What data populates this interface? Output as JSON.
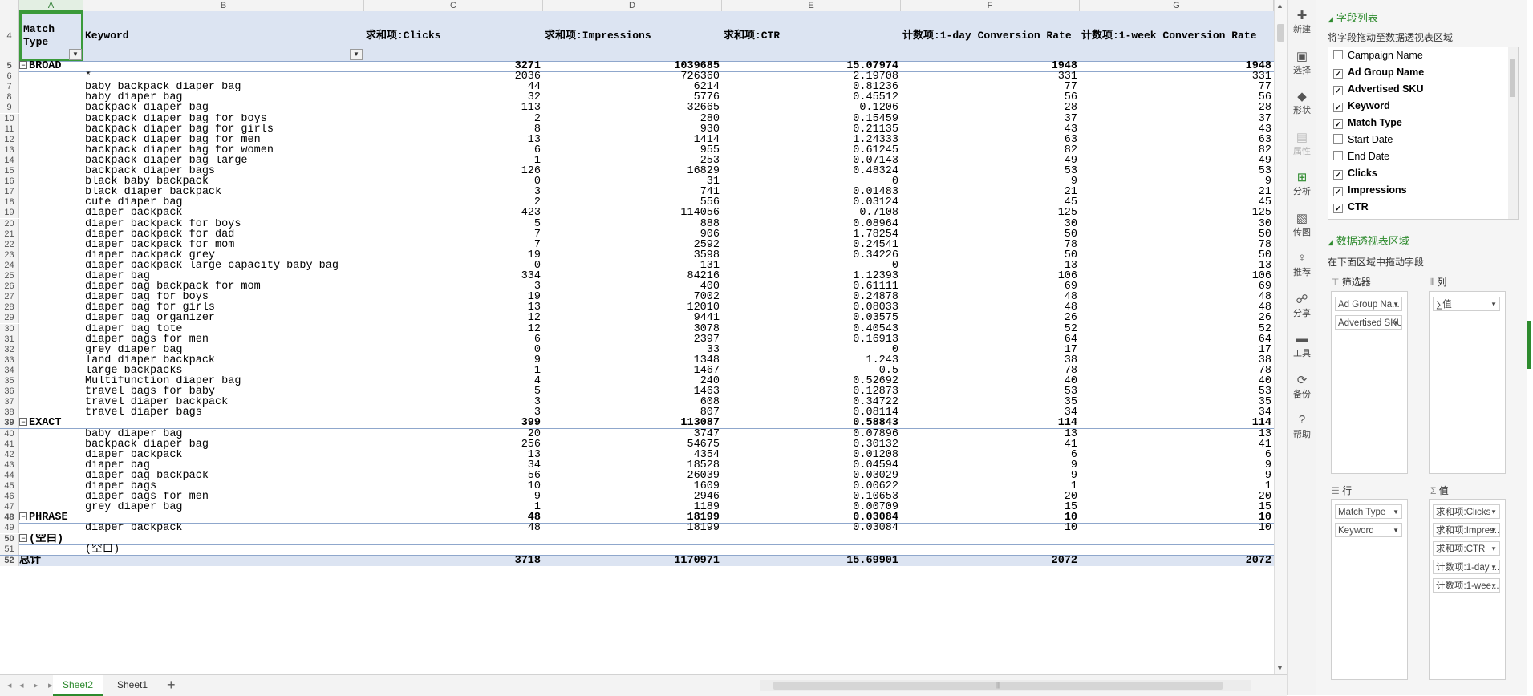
{
  "columns": [
    "A",
    "B",
    "C",
    "D",
    "E",
    "F",
    "G"
  ],
  "header": {
    "row_num": "4",
    "cells": [
      "Match Type",
      "Keyword",
      "求和项:Clicks",
      "求和项:Impressions",
      "求和项:CTR",
      "计数项:1-day Conversion Rate",
      "计数项:1-week Conversion Rate"
    ]
  },
  "rows": [
    {
      "n": "5",
      "kind": "group",
      "label": "BROAD",
      "vals": [
        "3271",
        "1039685",
        "15.07974",
        "1948",
        "1948"
      ]
    },
    {
      "n": "6",
      "kw": "*",
      "vals": [
        "2036",
        "726360",
        "2.19708",
        "331",
        "331"
      ]
    },
    {
      "n": "7",
      "kw": "baby backpack diaper bag",
      "vals": [
        "44",
        "6214",
        "0.81236",
        "77",
        "77"
      ]
    },
    {
      "n": "8",
      "kw": "baby diaper bag",
      "vals": [
        "32",
        "5776",
        "0.45512",
        "56",
        "56"
      ]
    },
    {
      "n": "9",
      "kw": "backpack diaper bag",
      "vals": [
        "113",
        "32665",
        "0.1206",
        "28",
        "28"
      ]
    },
    {
      "n": "10",
      "kw": "backpack diaper bag for boys",
      "vals": [
        "2",
        "280",
        "0.15459",
        "37",
        "37"
      ]
    },
    {
      "n": "11",
      "kw": "backpack diaper bag for girls",
      "vals": [
        "8",
        "930",
        "0.21135",
        "43",
        "43"
      ]
    },
    {
      "n": "12",
      "kw": "backpack diaper bag for men",
      "vals": [
        "13",
        "1414",
        "1.24333",
        "63",
        "63"
      ]
    },
    {
      "n": "13",
      "kw": "backpack diaper bag for women",
      "vals": [
        "6",
        "955",
        "0.61245",
        "82",
        "82"
      ]
    },
    {
      "n": "14",
      "kw": "backpack diaper bag large",
      "vals": [
        "1",
        "253",
        "0.07143",
        "49",
        "49"
      ]
    },
    {
      "n": "15",
      "kw": "backpack diaper bags",
      "vals": [
        "126",
        "16829",
        "0.48324",
        "53",
        "53"
      ]
    },
    {
      "n": "16",
      "kw": "black baby backpack",
      "vals": [
        "0",
        "31",
        "0",
        "9",
        "9"
      ]
    },
    {
      "n": "17",
      "kw": "black diaper backpack",
      "vals": [
        "3",
        "741",
        "0.01483",
        "21",
        "21"
      ]
    },
    {
      "n": "18",
      "kw": "cute diaper bag",
      "vals": [
        "2",
        "556",
        "0.03124",
        "45",
        "45"
      ]
    },
    {
      "n": "19",
      "kw": "diaper backpack",
      "vals": [
        "423",
        "114056",
        "0.7108",
        "125",
        "125"
      ]
    },
    {
      "n": "20",
      "kw": "diaper backpack for boys",
      "vals": [
        "5",
        "888",
        "0.08964",
        "30",
        "30"
      ]
    },
    {
      "n": "21",
      "kw": "diaper backpack for dad",
      "vals": [
        "7",
        "906",
        "1.78254",
        "50",
        "50"
      ]
    },
    {
      "n": "22",
      "kw": "diaper backpack for mom",
      "vals": [
        "7",
        "2592",
        "0.24541",
        "78",
        "78"
      ]
    },
    {
      "n": "23",
      "kw": "diaper backpack grey",
      "vals": [
        "19",
        "3598",
        "0.34226",
        "50",
        "50"
      ]
    },
    {
      "n": "24",
      "kw": "diaper backpack large capacity baby bag",
      "vals": [
        "0",
        "131",
        "0",
        "13",
        "13"
      ]
    },
    {
      "n": "25",
      "kw": "diaper bag",
      "vals": [
        "334",
        "84216",
        "1.12393",
        "106",
        "106"
      ]
    },
    {
      "n": "26",
      "kw": "diaper bag backpack for mom",
      "vals": [
        "3",
        "400",
        "0.61111",
        "69",
        "69"
      ]
    },
    {
      "n": "27",
      "kw": "diaper bag for boys",
      "vals": [
        "19",
        "7002",
        "0.24878",
        "48",
        "48"
      ]
    },
    {
      "n": "28",
      "kw": "diaper bag for girls",
      "vals": [
        "13",
        "12010",
        "0.08033",
        "48",
        "48"
      ]
    },
    {
      "n": "29",
      "kw": "diaper bag organizer",
      "vals": [
        "12",
        "9441",
        "0.03575",
        "26",
        "26"
      ]
    },
    {
      "n": "30",
      "kw": "diaper bag tote",
      "vals": [
        "12",
        "3078",
        "0.40543",
        "52",
        "52"
      ]
    },
    {
      "n": "31",
      "kw": "diaper bags for men",
      "vals": [
        "6",
        "2397",
        "0.16913",
        "64",
        "64"
      ]
    },
    {
      "n": "32",
      "kw": "grey diaper bag",
      "vals": [
        "0",
        "33",
        "0",
        "17",
        "17"
      ]
    },
    {
      "n": "33",
      "kw": "land diaper backpack",
      "vals": [
        "9",
        "1348",
        "1.243",
        "38",
        "38"
      ]
    },
    {
      "n": "34",
      "kw": "large backpacks",
      "vals": [
        "1",
        "1467",
        "0.5",
        "78",
        "78"
      ]
    },
    {
      "n": "35",
      "kw": "Multifunction diaper bag",
      "vals": [
        "4",
        "240",
        "0.52692",
        "40",
        "40"
      ]
    },
    {
      "n": "36",
      "kw": "travel bags for baby",
      "vals": [
        "5",
        "1463",
        "0.12873",
        "53",
        "53"
      ]
    },
    {
      "n": "37",
      "kw": "travel diaper backpack",
      "vals": [
        "3",
        "608",
        "0.34722",
        "35",
        "35"
      ]
    },
    {
      "n": "38",
      "kw": "travel diaper bags",
      "vals": [
        "3",
        "807",
        "0.08114",
        "34",
        "34"
      ]
    },
    {
      "n": "39",
      "kind": "group",
      "label": "EXACT",
      "vals": [
        "399",
        "113087",
        "0.58843",
        "114",
        "114"
      ]
    },
    {
      "n": "40",
      "kw": "baby diaper bag",
      "vals": [
        "20",
        "3747",
        "0.07896",
        "13",
        "13"
      ]
    },
    {
      "n": "41",
      "kw": "backpack diaper bag",
      "vals": [
        "256",
        "54675",
        "0.30132",
        "41",
        "41"
      ]
    },
    {
      "n": "42",
      "kw": "diaper backpack",
      "vals": [
        "13",
        "4354",
        "0.01208",
        "6",
        "6"
      ]
    },
    {
      "n": "43",
      "kw": "diaper bag",
      "vals": [
        "34",
        "18528",
        "0.04594",
        "9",
        "9"
      ]
    },
    {
      "n": "44",
      "kw": "diaper bag backpack",
      "vals": [
        "56",
        "26039",
        "0.03029",
        "9",
        "9"
      ]
    },
    {
      "n": "45",
      "kw": "diaper bags",
      "vals": [
        "10",
        "1609",
        "0.00622",
        "1",
        "1"
      ]
    },
    {
      "n": "46",
      "kw": "diaper bags for men",
      "vals": [
        "9",
        "2946",
        "0.10653",
        "20",
        "20"
      ]
    },
    {
      "n": "47",
      "kw": "grey diaper bag",
      "vals": [
        "1",
        "1189",
        "0.00709",
        "15",
        "15"
      ]
    },
    {
      "n": "48",
      "kind": "group",
      "label": "PHRASE",
      "vals": [
        "48",
        "18199",
        "0.03084",
        "10",
        "10"
      ]
    },
    {
      "n": "49",
      "kw": "diaper backpack",
      "vals": [
        "48",
        "18199",
        "0.03084",
        "10",
        "10"
      ]
    },
    {
      "n": "50",
      "kind": "group",
      "label": "(空白)",
      "vals": [
        "",
        "",
        "",
        "",
        ""
      ]
    },
    {
      "n": "51",
      "kw": "(空白)",
      "vals": [
        "",
        "",
        "",
        "",
        ""
      ]
    },
    {
      "n": "52",
      "kind": "total",
      "label": "总计",
      "vals": [
        "3718",
        "1170971",
        "15.69901",
        "2072",
        "2072"
      ]
    }
  ],
  "sheet_tabs": [
    "Sheet2",
    "Sheet1"
  ],
  "active_sheet": "Sheet2",
  "nav_buttons": [
    "|◂",
    "◂",
    "▸",
    "▸|"
  ],
  "tools": [
    {
      "label": "新建",
      "icon": "new-icon",
      "glyph": "✚",
      "state": "normal"
    },
    {
      "label": "选择",
      "icon": "select-icon",
      "glyph": "▣",
      "state": "normal"
    },
    {
      "label": "形状",
      "icon": "shape-icon",
      "glyph": "◆",
      "state": "normal"
    },
    {
      "label": "属性",
      "icon": "properties-icon",
      "glyph": "▤",
      "state": "dim"
    },
    {
      "label": "分析",
      "icon": "analysis-icon",
      "glyph": "⊞",
      "state": "active"
    },
    {
      "label": "传图",
      "icon": "upload-image-icon",
      "glyph": "▧",
      "state": "normal"
    },
    {
      "label": "推荐",
      "icon": "recommend-icon",
      "glyph": "♀",
      "state": "normal"
    },
    {
      "label": "分享",
      "icon": "share-icon",
      "glyph": "☍",
      "state": "normal"
    },
    {
      "label": "工具",
      "icon": "toolbox-icon",
      "glyph": "▬",
      "state": "normal"
    },
    {
      "label": "备份",
      "icon": "backup-icon",
      "glyph": "⟳",
      "state": "normal"
    },
    {
      "label": "帮助",
      "icon": "help-icon",
      "glyph": "?",
      "state": "normal"
    }
  ],
  "panel": {
    "field_list_title": "字段列表",
    "field_list_hint": "将字段拖动至数据透视表区域",
    "fields": [
      {
        "name": "Campaign Name",
        "checked": false
      },
      {
        "name": "Ad Group Name",
        "checked": true
      },
      {
        "name": "Advertised SKU",
        "checked": true
      },
      {
        "name": "Keyword",
        "checked": true
      },
      {
        "name": "Match Type",
        "checked": true
      },
      {
        "name": "Start Date",
        "checked": false
      },
      {
        "name": "End Date",
        "checked": false
      },
      {
        "name": "Clicks",
        "checked": true
      },
      {
        "name": "Impressions",
        "checked": true
      },
      {
        "name": "CTR",
        "checked": true
      }
    ],
    "area_title": "数据透视表区域",
    "area_hint": "在下面区域中拖动字段",
    "filters_label": "筛选器",
    "columns_label": "列",
    "rows_label": "行",
    "values_label": "值",
    "filter_chips": [
      "Ad Group Na...",
      "Advertised SKU"
    ],
    "column_chips": [
      "∑值"
    ],
    "row_chips": [
      "Match Type",
      "Keyword"
    ],
    "value_chips": [
      "求和项:Clicks",
      "求和项:Impres...",
      "求和项:CTR",
      "计数项:1-day ...",
      "计数项:1-wee..."
    ]
  },
  "colors": {
    "accent": "#2e8b2e",
    "header_bg": "#dce4f2",
    "group_line": "#8fa7cc"
  }
}
